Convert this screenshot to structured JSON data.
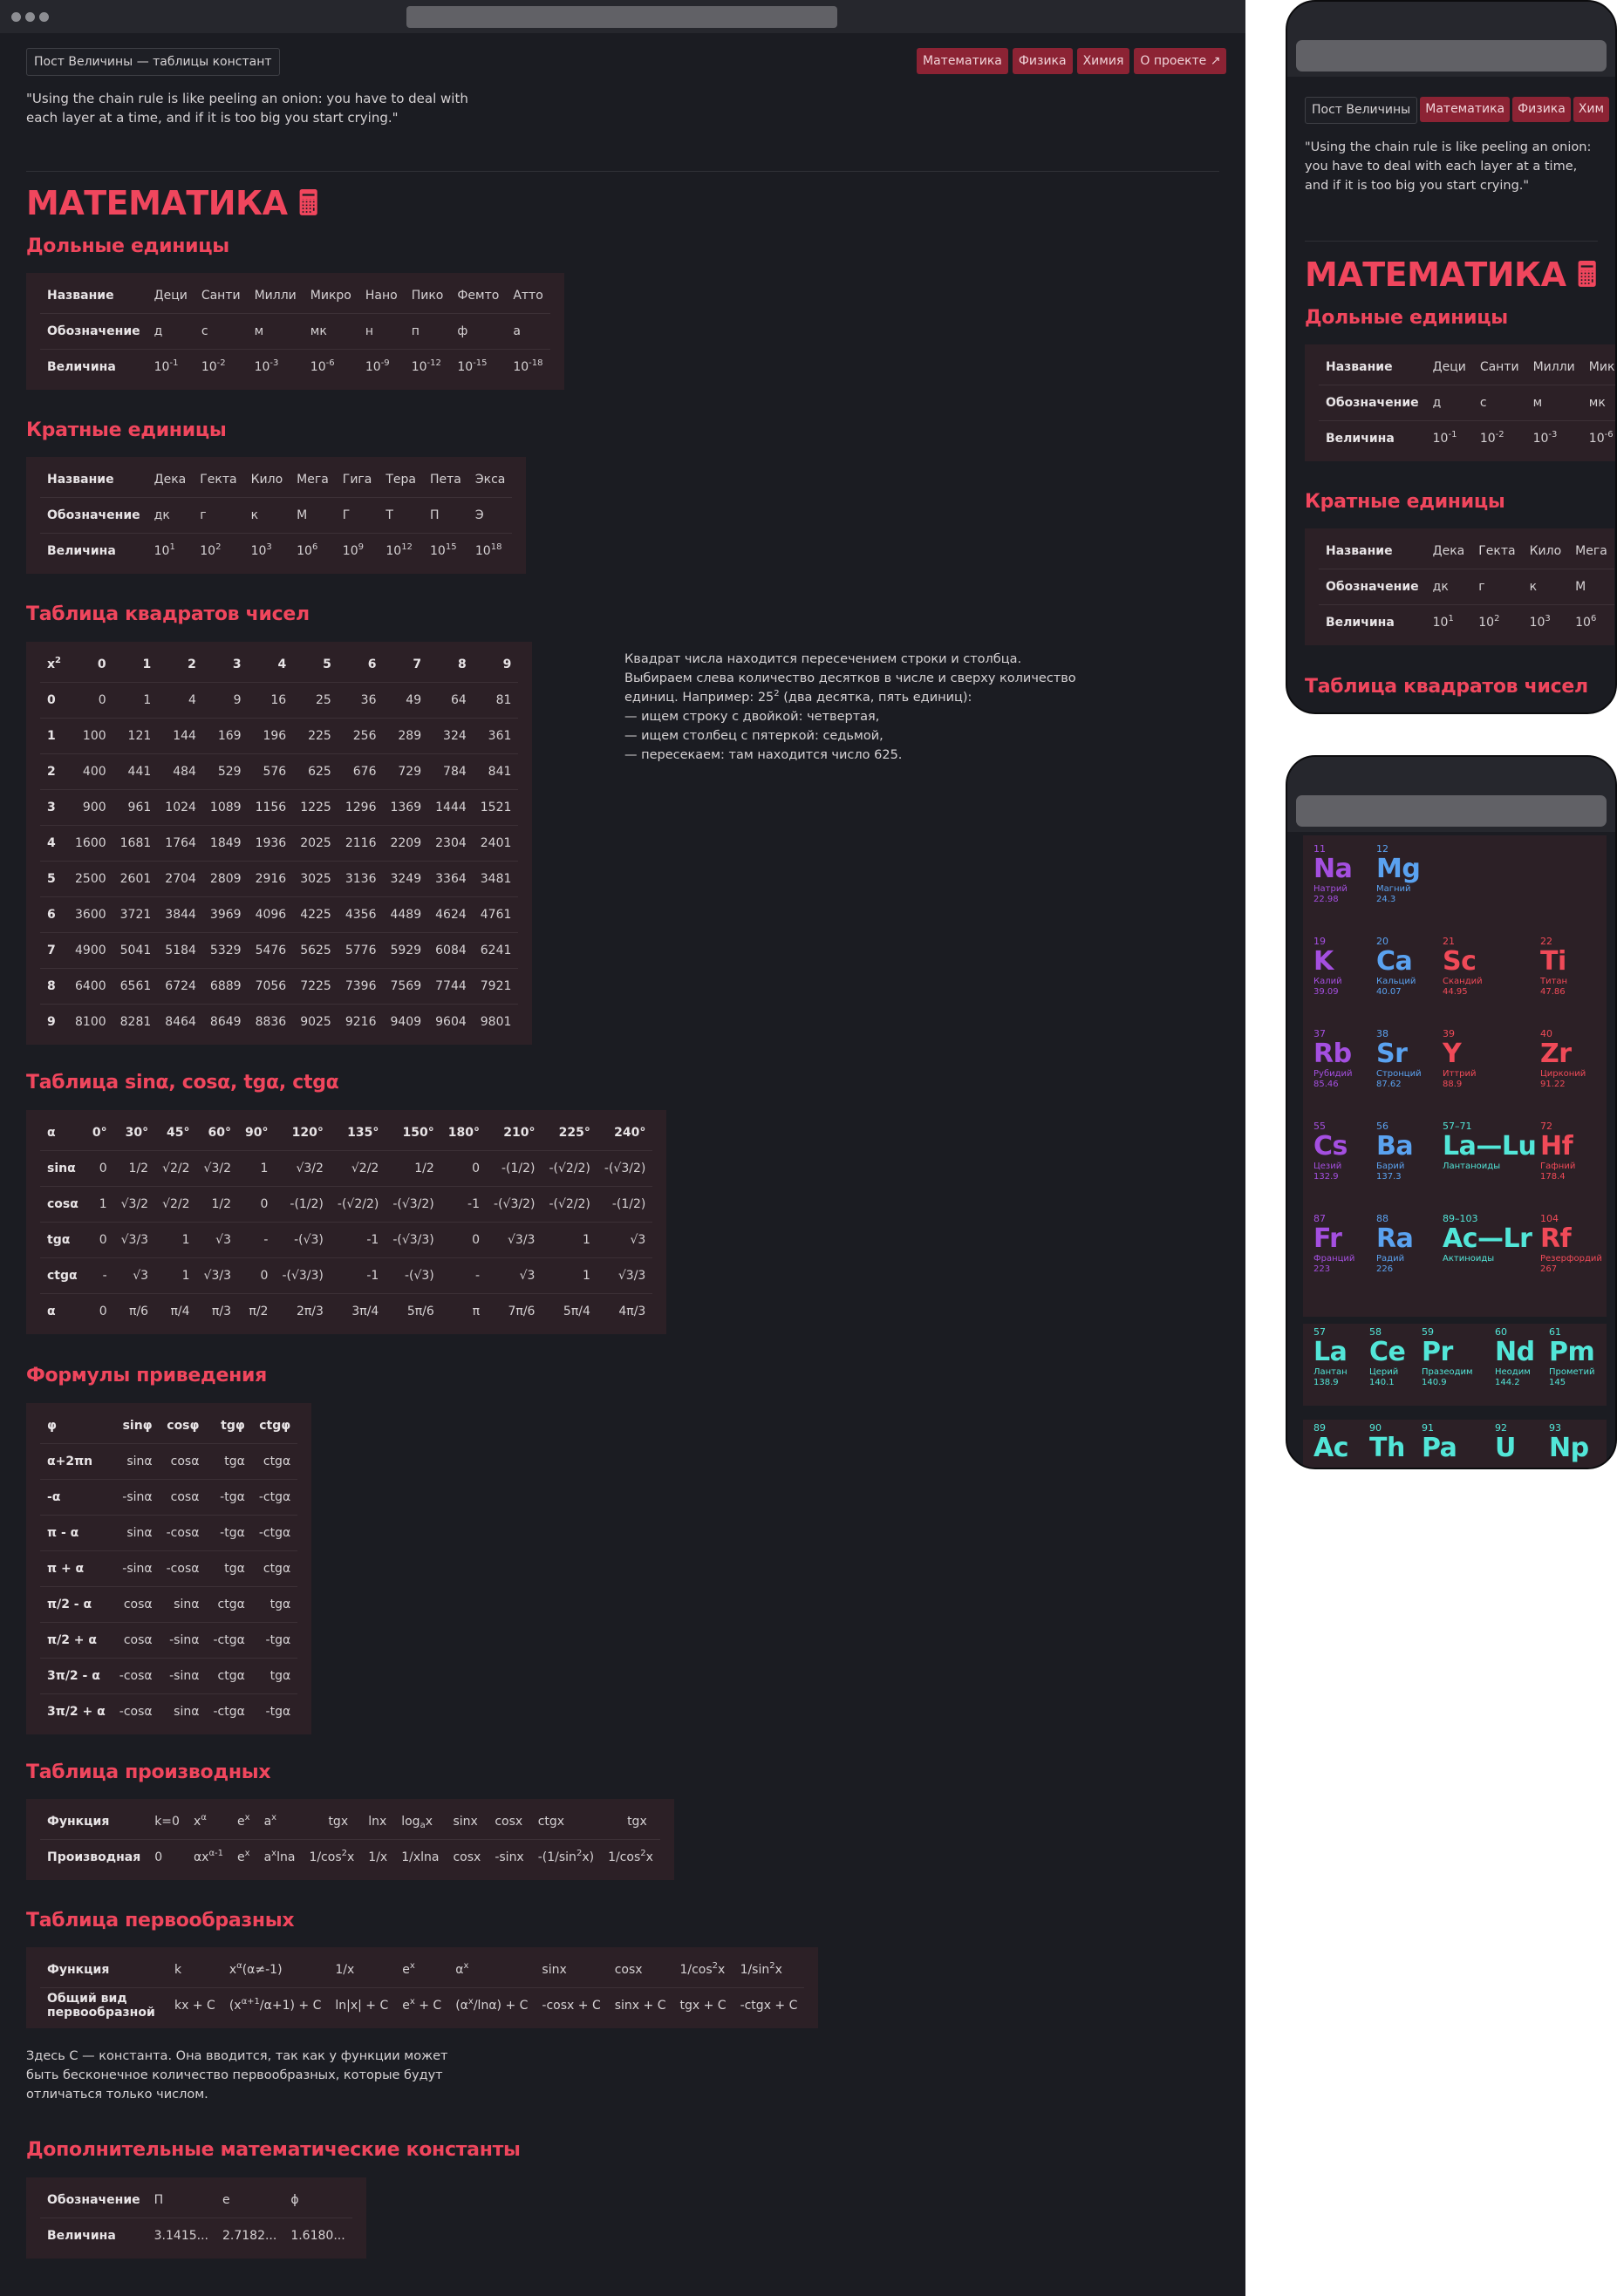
{
  "site": {
    "title": "Пост Величины — таблицы констант",
    "mobile_title": "Пост Величины",
    "quote": "\"Using the chain rule is like peeling an onion: you have to deal with each layer at a time, and if it is too big you start crying.\"",
    "nav": [
      "Математика",
      "Физика",
      "Химия",
      "О проекте ↗"
    ],
    "mobile_nav": [
      "Математика",
      "Физика",
      "Хим"
    ]
  },
  "math": {
    "heading": "МАТЕМАТИКА 🖩",
    "fractional": {
      "heading": "Дольные единицы",
      "rows": [
        [
          "Название",
          "Деци",
          "Санти",
          "Милли",
          "Микро",
          "Нано",
          "Пико",
          "Фемто",
          "Атто"
        ],
        [
          "Обозначение",
          "д",
          "с",
          "м",
          "мк",
          "н",
          "п",
          "ф",
          "а"
        ]
      ],
      "value_label": "Величина",
      "exponents": [
        "-1",
        "-2",
        "-3",
        "-6",
        "-9",
        "-12",
        "-15",
        "-18"
      ],
      "base": "10"
    },
    "multiple": {
      "heading": "Кратные единицы",
      "rows": [
        [
          "Название",
          "Дека",
          "Гекта",
          "Кило",
          "Мега",
          "Гига",
          "Тера",
          "Пета",
          "Экса"
        ],
        [
          "Обозначение",
          "дк",
          "г",
          "к",
          "М",
          "Г",
          "Т",
          "П",
          "Э"
        ]
      ],
      "value_label": "Величина",
      "exponents": [
        "1",
        "2",
        "3",
        "6",
        "9",
        "12",
        "15",
        "18"
      ],
      "base": "10"
    },
    "squares": {
      "heading": "Таблица квадратов чисел",
      "corner": "x",
      "corner_sup": "2",
      "cols": [
        "0",
        "1",
        "2",
        "3",
        "4",
        "5",
        "6",
        "7",
        "8",
        "9"
      ],
      "rows": [
        [
          "0",
          "0",
          "1",
          "4",
          "9",
          "16",
          "25",
          "36",
          "49",
          "64",
          "81"
        ],
        [
          "1",
          "100",
          "121",
          "144",
          "169",
          "196",
          "225",
          "256",
          "289",
          "324",
          "361"
        ],
        [
          "2",
          "400",
          "441",
          "484",
          "529",
          "576",
          "625",
          "676",
          "729",
          "784",
          "841"
        ],
        [
          "3",
          "900",
          "961",
          "1024",
          "1089",
          "1156",
          "1225",
          "1296",
          "1369",
          "1444",
          "1521"
        ],
        [
          "4",
          "1600",
          "1681",
          "1764",
          "1849",
          "1936",
          "2025",
          "2116",
          "2209",
          "2304",
          "2401"
        ],
        [
          "5",
          "2500",
          "2601",
          "2704",
          "2809",
          "2916",
          "3025",
          "3136",
          "3249",
          "3364",
          "3481"
        ],
        [
          "6",
          "3600",
          "3721",
          "3844",
          "3969",
          "4096",
          "4225",
          "4356",
          "4489",
          "4624",
          "4761"
        ],
        [
          "7",
          "4900",
          "5041",
          "5184",
          "5329",
          "5476",
          "5625",
          "5776",
          "5929",
          "6084",
          "6241"
        ],
        [
          "8",
          "6400",
          "6561",
          "6724",
          "6889",
          "7056",
          "7225",
          "7396",
          "7569",
          "7744",
          "7921"
        ],
        [
          "9",
          "8100",
          "8281",
          "8464",
          "8649",
          "8836",
          "9025",
          "9216",
          "9409",
          "9604",
          "9801"
        ]
      ],
      "note": {
        "line1": "Квадрат числа находится пересечением строки и столбца.",
        "line2": "Выбираем слева количество десятков в числе и сверху количество",
        "line3a": "единиц. Например: 25",
        "line3sup": "2",
        "line3b": " (два десятка, пять единиц):",
        "line4": "— ищем строку с двойкой: четвертая,",
        "line5": "— ищем столбец с пятеркой: седьмой,",
        "line6": "— пересекаем: там находится число 625."
      }
    },
    "trig": {
      "heading": "Таблица sinα, cosα, tgα, ctgα",
      "rows": [
        [
          "α",
          "0°",
          "30°",
          "45°",
          "60°",
          "90°",
          "120°",
          "135°",
          "150°",
          "180°",
          "210°",
          "225°",
          "240°"
        ],
        [
          "sinα",
          "0",
          "1/2",
          "√2/2",
          "√3/2",
          "1",
          "√3/2",
          "√2/2",
          "1/2",
          "0",
          "-(1/2)",
          "-(√2/2)",
          "-(√3/2)"
        ],
        [
          "cosα",
          "1",
          "√3/2",
          "√2/2",
          "1/2",
          "0",
          "-(1/2)",
          "-(√2/2)",
          "-(√3/2)",
          "-1",
          "-(√3/2)",
          "-(√2/2)",
          "-(1/2)"
        ],
        [
          "tgα",
          "0",
          "√3/3",
          "1",
          "√3",
          "-",
          "-(√3)",
          "-1",
          "-(√3/3)",
          "0",
          "√3/3",
          "1",
          "√3"
        ],
        [
          "ctgα",
          "-",
          "√3",
          "1",
          "√3/3",
          "0",
          "-(√3/3)",
          "-1",
          "-(√3)",
          "-",
          "√3",
          "1",
          "√3/3"
        ],
        [
          "α",
          "0",
          "π/6",
          "π/4",
          "π/3",
          "π/2",
          "2π/3",
          "3π/4",
          "5π/6",
          "π",
          "7π/6",
          "5π/4",
          "4π/3"
        ]
      ]
    },
    "reduction": {
      "heading": "Формулы приведения",
      "rows": [
        [
          "φ",
          "sinφ",
          "cosφ",
          "tgφ",
          "ctgφ"
        ],
        [
          "α+2πn",
          "sinα",
          "cosα",
          "tgα",
          "ctgα"
        ],
        [
          "-α",
          "-sinα",
          "cosα",
          "-tgα",
          "-ctgα"
        ],
        [
          "π - α",
          "sinα",
          "-cosα",
          "-tgα",
          "-ctgα"
        ],
        [
          "π + α",
          "-sinα",
          "-cosα",
          "tgα",
          "ctgα"
        ],
        [
          "π/2 - α",
          "cosα",
          "sinα",
          "ctgα",
          "tgα"
        ],
        [
          "π/2 + α",
          "cosα",
          "-sinα",
          "-ctgα",
          "-tgα"
        ],
        [
          "3π/2 - α",
          "-cosα",
          "-sinα",
          "ctgα",
          "tgα"
        ],
        [
          "3π/2 + α",
          "-cosα",
          "sinα",
          "-ctgα",
          "-tgα"
        ]
      ]
    },
    "derivatives": {
      "heading": "Таблица производных",
      "label_func": "Функция",
      "label_deriv": "Производная",
      "funcs": [
        "k=0",
        "x",
        "α",
        "e",
        "x",
        "a",
        "x",
        "tgx",
        "lnx",
        "log",
        "a",
        "x",
        "sinx",
        "cosx",
        "ctgx",
        "tgx"
      ],
      "derivs": [
        "0",
        "αx",
        "α-1",
        "e",
        "x",
        "a",
        "x",
        "lna",
        "1/cos",
        "2",
        "x",
        "1/x",
        "1/xlna",
        "cosx",
        "-sinx",
        "-(1/sin",
        "2",
        "x)",
        "1/cos",
        "2",
        "x"
      ]
    },
    "antiderivatives": {
      "heading": "Таблица первообразных",
      "label_func": "Функция",
      "label_general": "Общий вид первообразной",
      "funcs": [
        "k",
        "x",
        "α",
        "(α≠-1)",
        "1/x",
        "e",
        "x",
        "α",
        "x",
        "sinx",
        "cosx",
        "1/cos",
        "2",
        "x",
        "1/sin",
        "2",
        "x"
      ],
      "general": [
        "kx + C",
        "(x",
        "α+1",
        "/α+1) + C",
        "ln|x| + C",
        "e",
        "x",
        "+ C",
        "(α",
        "x",
        "/lnα) + C",
        "-cosx + C",
        "sinx + C",
        "tgx + C",
        "-ctgx + C"
      ],
      "note": "Здесь C — константа. Она вводится, так как у функции может быть бесконечное количество первообразных, которые будут отличаться только числом."
    },
    "constants": {
      "heading": "Дополнительные математические константы",
      "label_sym": "Обозначение",
      "label_val": "Величина",
      "symbols": [
        "Π",
        "e",
        "ϕ"
      ],
      "values": [
        "3.1415...",
        "2.7182...",
        "1.6180..."
      ]
    }
  },
  "periodic": {
    "elements": [
      {
        "n": "11",
        "s": "Na",
        "name": "Натрий",
        "m": "22.98",
        "cls": "c-alk"
      },
      {
        "n": "12",
        "s": "Mg",
        "name": "Магний",
        "m": "24.3",
        "cls": "c-aem"
      },
      {
        "n": "19",
        "s": "K",
        "name": "Калий",
        "m": "39.09",
        "cls": "c-alk"
      },
      {
        "n": "20",
        "s": "Ca",
        "name": "Кальций",
        "m": "40.07",
        "cls": "c-aem"
      },
      {
        "n": "21",
        "s": "Sc",
        "name": "Скандий",
        "m": "44.95",
        "cls": "c-tr"
      },
      {
        "n": "22",
        "s": "Ti",
        "name": "Титан",
        "m": "47.86",
        "cls": "c-tr"
      },
      {
        "n": "37",
        "s": "Rb",
        "name": "Рубидий",
        "m": "85.46",
        "cls": "c-alk"
      },
      {
        "n": "38",
        "s": "Sr",
        "name": "Стронций",
        "m": "87.62",
        "cls": "c-aem"
      },
      {
        "n": "39",
        "s": "Y",
        "name": "Иттрий",
        "m": "88.9",
        "cls": "c-tr"
      },
      {
        "n": "40",
        "s": "Zr",
        "name": "Цирконий",
        "m": "91.22",
        "cls": "c-tr"
      },
      {
        "n": "55",
        "s": "Cs",
        "name": "Цезий",
        "m": "132.9",
        "cls": "c-alk"
      },
      {
        "n": "56",
        "s": "Ba",
        "name": "Барий",
        "m": "137.3",
        "cls": "c-aem"
      },
      {
        "n": "57–71",
        "s": "La—Lu",
        "name": "Лантаноиды",
        "m": "",
        "cls": "c-lan"
      },
      {
        "n": "72",
        "s": "Hf",
        "name": "Гафний",
        "m": "178.4",
        "cls": "c-tr"
      },
      {
        "n": "87",
        "s": "Fr",
        "name": "Франций",
        "m": "223",
        "cls": "c-alk"
      },
      {
        "n": "88",
        "s": "Ra",
        "name": "Радий",
        "m": "226",
        "cls": "c-aem"
      },
      {
        "n": "89–103",
        "s": "Ac—Lr",
        "name": "Актиноиды",
        "m": "",
        "cls": "c-lan"
      },
      {
        "n": "104",
        "s": "Rf",
        "name": "Резерфордий",
        "m": "267",
        "cls": "c-tr"
      },
      {
        "n": "57",
        "s": "La",
        "name": "Лантан",
        "m": "138.9",
        "cls": "c-lan"
      },
      {
        "n": "58",
        "s": "Ce",
        "name": "Церий",
        "m": "140.1",
        "cls": "c-lan"
      },
      {
        "n": "59",
        "s": "Pr",
        "name": "Празеодим",
        "m": "140.9",
        "cls": "c-lan"
      },
      {
        "n": "60",
        "s": "Nd",
        "name": "Неодим",
        "m": "144.2",
        "cls": "c-lan"
      },
      {
        "n": "61",
        "s": "Pm",
        "name": "Прометий",
        "m": "145",
        "cls": "c-lan"
      },
      {
        "n": "89",
        "s": "Ac",
        "name": "",
        "m": "",
        "cls": "c-lan"
      },
      {
        "n": "90",
        "s": "Th",
        "name": "",
        "m": "",
        "cls": "c-lan"
      },
      {
        "n": "91",
        "s": "Pa",
        "name": "",
        "m": "",
        "cls": "c-lan"
      },
      {
        "n": "92",
        "s": "U",
        "name": "",
        "m": "",
        "cls": "c-lan"
      },
      {
        "n": "93",
        "s": "Np",
        "name": "",
        "m": "",
        "cls": "c-lan"
      }
    ]
  },
  "colors": {
    "accent": "#f0465d",
    "nav_bg": "#8c2334",
    "page_bg": "#1b1c22",
    "table_bg": "#2c2026",
    "alkali": "#a44fe0",
    "alkaline_earth": "#5aa2f0",
    "transition": "#f04a58",
    "lanthanide": "#52e6d8"
  }
}
